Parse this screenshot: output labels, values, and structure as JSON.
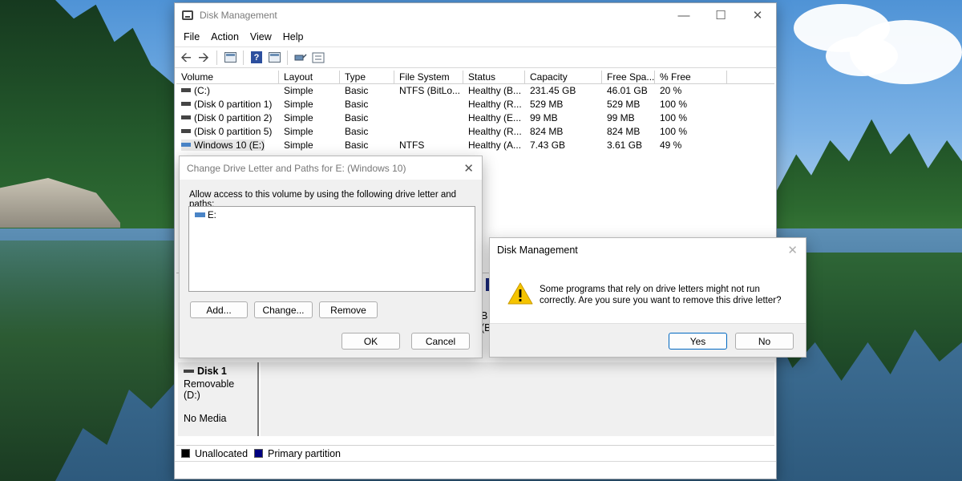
{
  "window": {
    "title": "Disk Management",
    "controls": {
      "minimize": "—",
      "maximize": "☐",
      "close": "✕"
    }
  },
  "menu": [
    "File",
    "Action",
    "View",
    "Help"
  ],
  "volume_table": {
    "columns": [
      "Volume",
      "Layout",
      "Type",
      "File System",
      "Status",
      "Capacity",
      "Free Spa...",
      "% Free"
    ],
    "rows": [
      {
        "volume": "(C:)",
        "layout": "Simple",
        "type": "Basic",
        "fs": "NTFS (BitLo...",
        "status": "Healthy (B...",
        "capacity": "231.45 GB",
        "free": "46.01 GB",
        "pct": "20 %"
      },
      {
        "volume": "(Disk 0 partition 1)",
        "layout": "Simple",
        "type": "Basic",
        "fs": "",
        "status": "Healthy (R...",
        "capacity": "529 MB",
        "free": "529 MB",
        "pct": "100 %"
      },
      {
        "volume": "(Disk 0 partition 2)",
        "layout": "Simple",
        "type": "Basic",
        "fs": "",
        "status": "Healthy (E...",
        "capacity": "99 MB",
        "free": "99 MB",
        "pct": "100 %"
      },
      {
        "volume": "(Disk 0 partition 5)",
        "layout": "Simple",
        "type": "Basic",
        "fs": "",
        "status": "Healthy (R...",
        "capacity": "824 MB",
        "free": "824 MB",
        "pct": "100 %"
      },
      {
        "volume": "Windows 10 (E:)",
        "layout": "Simple",
        "type": "Basic",
        "fs": "NTFS",
        "status": "Healthy (A...",
        "capacity": "7.43 GB",
        "free": "3.61 GB",
        "pct": "49 %"
      }
    ]
  },
  "disk1": {
    "title": "Disk 1",
    "subtitle": "Removable (D:)",
    "media": "No Media"
  },
  "legend": [
    {
      "label": "Unallocated",
      "color": "#000000"
    },
    {
      "label": "Primary partition",
      "color": "#000080"
    }
  ],
  "change_dialog": {
    "title": "Change Drive Letter and Paths for E: (Windows 10)",
    "prompt": "Allow access to this volume by using the following drive letter and paths:",
    "paths": [
      "E:"
    ],
    "buttons": {
      "add": "Add...",
      "change": "Change...",
      "remove": "Remove",
      "ok": "OK",
      "cancel": "Cancel"
    }
  },
  "confirm_dialog": {
    "title": "Disk Management",
    "message": "Some programs that rely on drive letters might not run correctly. Are you sure you want to remove this drive letter?",
    "buttons": {
      "yes": "Yes",
      "no": "No"
    }
  },
  "partial_labels": {
    "a": "B",
    "b": "(B"
  },
  "colors": {
    "accent": "#0067c0",
    "warning": "#f5c400"
  }
}
